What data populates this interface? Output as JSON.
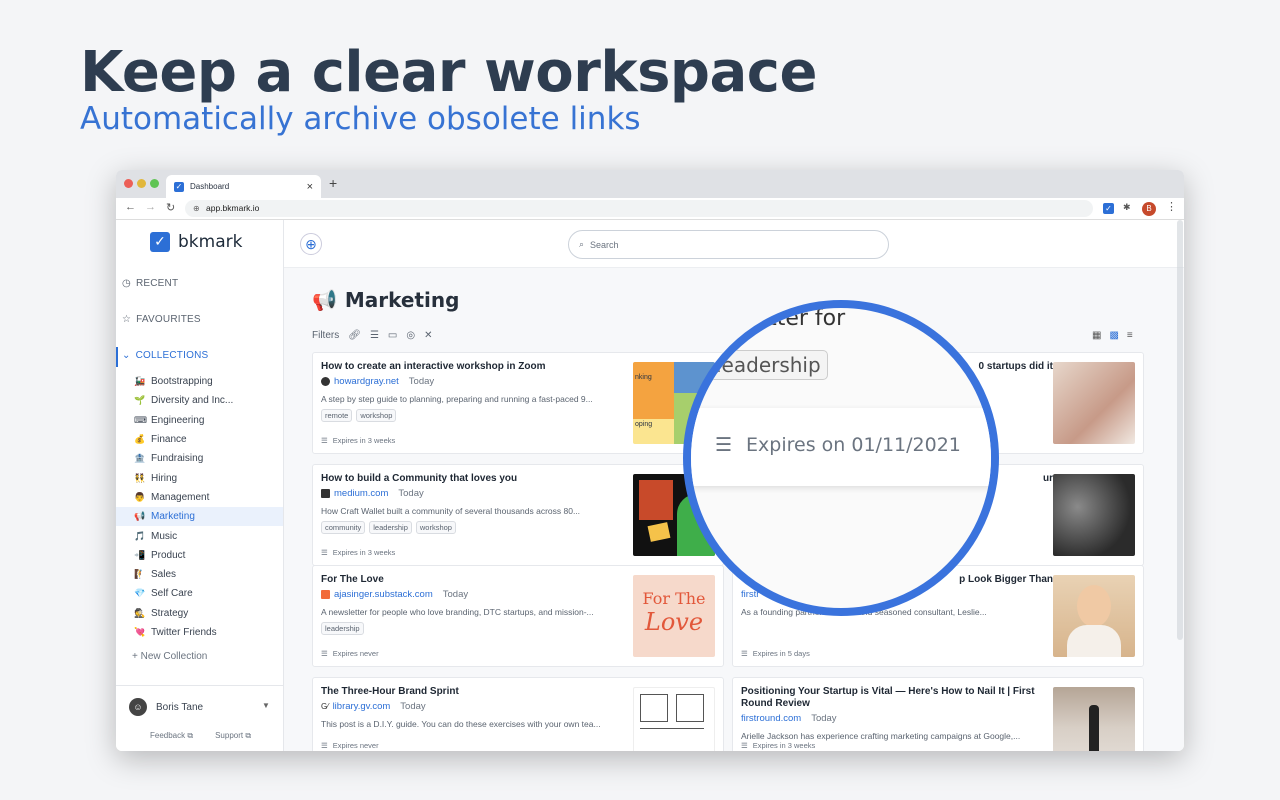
{
  "hero": {
    "title": "Keep a clear workspace",
    "subtitle": "Automatically archive obsolete links"
  },
  "browser": {
    "tab_title": "Dashboard",
    "tab_close": "×",
    "new_tab": "+",
    "url": "app.bkmark.io",
    "avatar_letter": "B"
  },
  "app": {
    "logo": "bkmark"
  },
  "sidebar": {
    "recent": "RECENT",
    "favourites": "FAVOURITES",
    "collections": "COLLECTIONS",
    "items": [
      {
        "emoji": "🚂",
        "label": "Bootstrapping"
      },
      {
        "emoji": "🌱",
        "label": "Diversity and Inc..."
      },
      {
        "emoji": "⌨",
        "label": "Engineering"
      },
      {
        "emoji": "💰",
        "label": "Finance"
      },
      {
        "emoji": "🏦",
        "label": "Fundraising"
      },
      {
        "emoji": "👯",
        "label": "Hiring"
      },
      {
        "emoji": "👨",
        "label": "Management"
      },
      {
        "emoji": "📢",
        "label": "Marketing"
      },
      {
        "emoji": "🎵",
        "label": "Music"
      },
      {
        "emoji": "📲",
        "label": "Product"
      },
      {
        "emoji": "🧗",
        "label": "Sales"
      },
      {
        "emoji": "💎",
        "label": "Self Care"
      },
      {
        "emoji": "🕵",
        "label": "Strategy"
      },
      {
        "emoji": "💘",
        "label": "Twitter Friends"
      }
    ],
    "new_collection": "+ New Collection",
    "user": "Boris Tane",
    "feedback": "Feedback ⧉",
    "support": "Support ⧉"
  },
  "main": {
    "search_placeholder": "Search",
    "title_emoji": "📢",
    "title": "Marketing",
    "filters_label": "Filters"
  },
  "cards": [
    {
      "title": "How to create an interactive workshop in Zoom",
      "source": "howardgray.net",
      "day": "Today",
      "desc": "A step by step guide to planning, preparing and running a fast-paced 9...",
      "tags": [
        "remote",
        "workshop"
      ],
      "expires": "Expires in 3 weeks"
    },
    {
      "title": "0 startups did it",
      "source": "",
      "day": "",
      "desc": "",
      "tags": [],
      "expires": ""
    },
    {
      "title": "How to build a Community that loves you",
      "source": "medium.com",
      "day": "Today",
      "desc": "How Craft Wallet built a community of several thousands across 80...",
      "tags": [
        "community",
        "leadership",
        "workshop"
      ],
      "expires": "Expires in 3 weeks"
    },
    {
      "title": "ur",
      "source": "",
      "day": "",
      "desc": "",
      "tags": [],
      "expires": ""
    },
    {
      "title": "For The Love",
      "source": "ajasinger.substack.com",
      "day": "Today",
      "desc": "A newsletter for people who love branding, DTC startups, and mission-...",
      "tags": [
        "leadership"
      ],
      "expires": "Expires never"
    },
    {
      "title": "p Look Bigger Than",
      "source": "firstr",
      "day": "",
      "desc": "As a founding partner... Health and seasoned consultant, Leslie...",
      "tags": [],
      "expires": "Expires in 5 days"
    },
    {
      "title": "The Three-Hour Brand Sprint",
      "source": "library.gv.com",
      "day": "Today",
      "desc": "This post is a D.I.Y. guide. You can do these exercises with your own tea...",
      "tags": [],
      "expires": "Expires never"
    },
    {
      "title": "Positioning Your Startup is Vital — Here's How to Nail It | First Round Review",
      "source": "firstround.com",
      "day": "Today",
      "desc": "Arielle Jackson has experience crafting marketing campaigns at Google,...",
      "tags": [],
      "expires": "Expires in 3 weeks"
    }
  ],
  "magnifier": {
    "partial_title": "sletter for",
    "tag": "leadership",
    "expires": "Expires on 01/11/2021"
  },
  "thumbs": {
    "zoom_labels": [
      "nking",
      "oping"
    ],
    "love_line1": "For The",
    "love_line2": "Love"
  }
}
